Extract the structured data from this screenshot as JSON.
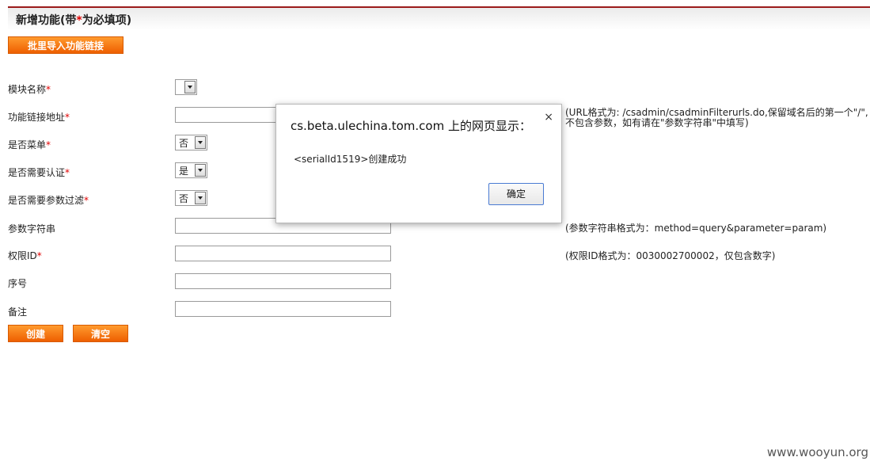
{
  "header": {
    "title": "新增功能(带",
    "star": "*",
    "title_suffix": "为必填项)"
  },
  "import_button": "批里导入功能链接",
  "required_star": "*",
  "form": {
    "module_name": {
      "label": "模块名称",
      "value": ""
    },
    "func_link": {
      "label": "功能链接地址",
      "hint_line1": "(URL格式为: /csadmin/csadminFilterurls.do,保留域名后的第一个\"/\",",
      "hint_line2": "不包含参数，如有请在\"参数字符串\"中填写)"
    },
    "is_menu": {
      "label": "是否菜单",
      "value": "否"
    },
    "need_auth": {
      "label": "是否需要认证",
      "value": "是"
    },
    "need_param_filter": {
      "label": "是否需要参数过滤",
      "value": "否"
    },
    "param_string": {
      "label": "参数字符串",
      "hint": "(参数字符串格式为：method=query&parameter=param)"
    },
    "permission_id": {
      "label": "权限ID",
      "hint": "(权限ID格式为：0030002700002，仅包含数字)"
    },
    "sequence": {
      "label": "序号"
    },
    "remark": {
      "label": "备注"
    }
  },
  "buttons": {
    "create": "创建",
    "clear": "清空"
  },
  "dialog": {
    "title": "cs.beta.ulechina.tom.com 上的网页显示：",
    "close": "×",
    "message": "<serialId1519>创建成功",
    "ok": "确定"
  },
  "watermark": "www.wooyun.org"
}
